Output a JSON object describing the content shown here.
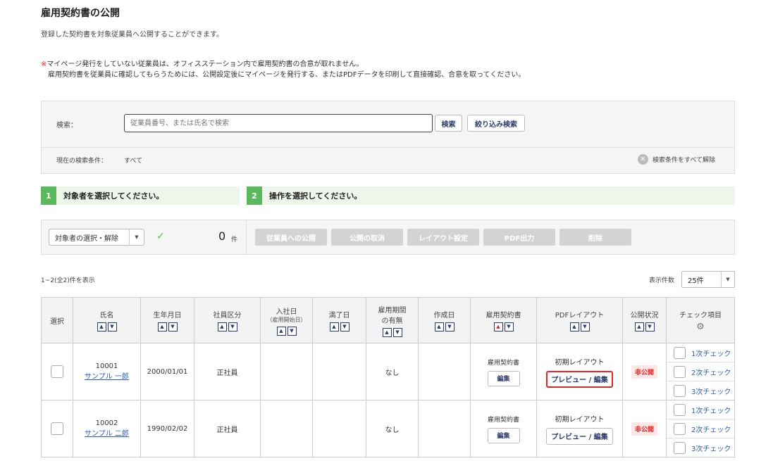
{
  "header": {
    "title": "雇用契約書の公開",
    "subtitle": "登録した契約書を対象従業員へ公開することができます。",
    "note_mark": "※",
    "note_line1": "マイページ発行をしていない従業員は、オフィスステーション内で雇用契約書の合意が取れません。",
    "note_line2": "雇用契約書を従業員に確認してもらうためには、公開設定後にマイページを発行する、またはPDFデータを印刷して直接確認、合意を取ってください。"
  },
  "search": {
    "label": "検索：",
    "placeholder": "従業員番号、または氏名で検索",
    "search_button": "検索",
    "filter_button": "絞り込み検索",
    "condition_label": "現在の検索条件：",
    "condition_value": "すべて",
    "clear_label": "検索条件をすべて解除"
  },
  "steps": [
    {
      "num": "1",
      "label": "対象者を選択してください。"
    },
    {
      "num": "2",
      "label": "操作を選択してください。"
    }
  ],
  "operations": {
    "select_label": "対象者の選択・解除",
    "count": "0",
    "count_unit": "件",
    "buttons": [
      "従業員への公開",
      "公開の取消",
      "レイアウト設定",
      "PDF出力",
      "削除"
    ]
  },
  "list": {
    "range_text": "1~2(全2)件を表示",
    "per_page_label": "表示件数",
    "per_page_value": "25件"
  },
  "table": {
    "headers": {
      "select": "選択",
      "name": "氏名",
      "birthday": "生年月日",
      "category": "社員区分",
      "hire_date": "入社日",
      "hire_date_sub": "（雇用開始日）",
      "expiry": "満了日",
      "term_line1": "雇用期間",
      "term_line2": "の有無",
      "created": "作成日",
      "contract": "雇用契約書",
      "pdf_layout": "PDFレイアウト",
      "status": "公開状況",
      "check_items": "チェック項目"
    },
    "rows": [
      {
        "emp_no": "10001",
        "name": "サンプル 一郎",
        "birthday": "2000/01/01",
        "category": "正社員",
        "hire_date": "",
        "expiry": "",
        "term": "なし",
        "created": "",
        "contract_label": "雇用契約書",
        "edit": "編集",
        "layout": "初期レイアウト",
        "preview": "プレビュー / 編集",
        "status": "非公開",
        "checks": [
          "1次チェック",
          "2次チェック",
          "3次チェック"
        ]
      },
      {
        "emp_no": "10002",
        "name": "サンプル 二郎",
        "birthday": "1990/02/02",
        "category": "正社員",
        "hire_date": "",
        "expiry": "",
        "term": "なし",
        "created": "",
        "contract_label": "雇用契約書",
        "edit": "編集",
        "layout": "初期レイアウト",
        "preview": "プレビュー / 編集",
        "status": "非公開",
        "checks": [
          "1次チェック",
          "2次チェック",
          "3次チェック"
        ]
      }
    ]
  },
  "colors": {
    "accent_green": "#5cb85c",
    "link_blue": "#2a5db0",
    "alert_red": "#e02424",
    "button_text_navy": "#2b3a6b",
    "disabled_gray": "#d3d3d3"
  }
}
